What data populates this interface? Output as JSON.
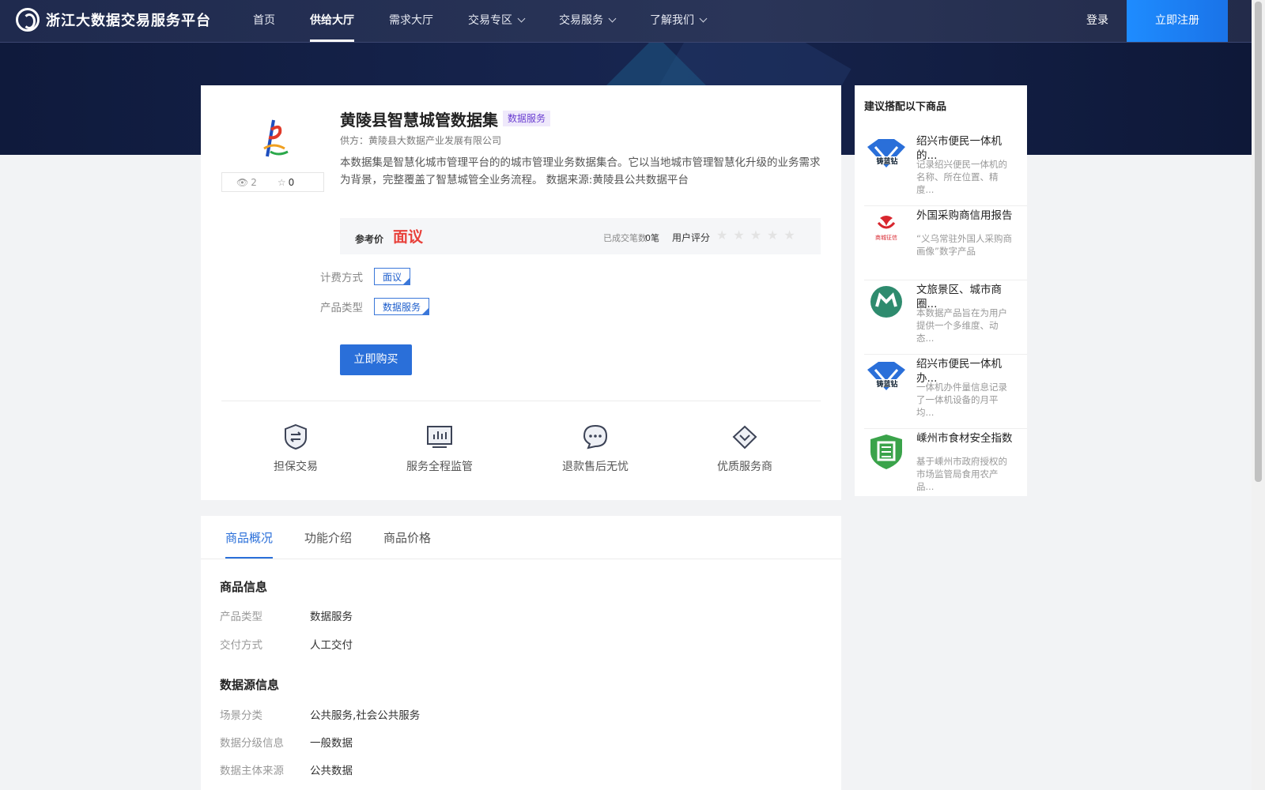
{
  "header": {
    "logo_text": "浙江大数据交易服务平台",
    "nav": [
      {
        "label": "首页"
      },
      {
        "label": "供给大厅"
      },
      {
        "label": "需求大厅"
      },
      {
        "label": "交易专区"
      },
      {
        "label": "交易服务"
      },
      {
        "label": "了解我们"
      }
    ],
    "login_label": "登录",
    "register_label": "立即注册"
  },
  "product": {
    "title": "黄陵县智慧城管数据集",
    "tag": "数据服务",
    "supplier": "供方：黄陵县大数据产业发展有限公司",
    "description": "本数据集是智慧化城市管理平台的的城市管理业务数据集合。它以当地城市管理智慧化升级的业务需求为背景，完整覆盖了智慧城管全业务流程。 数据来源:黄陵县公共数据平台",
    "views": "2",
    "favorites": "0",
    "ref_price_label": "参考价",
    "ref_price": "面议",
    "deal_count_label": "已成交笔数",
    "deal_count": "0笔",
    "rating_label": "用户评分",
    "rating": 0,
    "fee_label": "计费方式",
    "fee_value": "面议",
    "type_label": "产品类型",
    "type_value": "数据服务",
    "buy_label": "立即购买"
  },
  "features": [
    {
      "label": "担保交易",
      "icon": "shield-exchange-icon"
    },
    {
      "label": "服务全程监管",
      "icon": "monitor-chart-icon"
    },
    {
      "label": "退款售后无忧",
      "icon": "chat-bubble-icon"
    },
    {
      "label": "优质服务商",
      "icon": "diamond-icon"
    }
  ],
  "sidebar": {
    "title": "建议搭配以下商品",
    "items": [
      {
        "title": "绍兴市便民一体机的...",
        "desc": "记录绍兴便民一体机的名称、所在位置、精度...",
        "icon": "blue-diamond-logo-icon"
      },
      {
        "title": "外国采购商信用报告",
        "desc": "“义乌常驻外国人采购商画像”数字产品",
        "icon": "red-credit-logo-icon"
      },
      {
        "title": "文旅景区、城市商圈...",
        "desc": "本数据产品旨在为用户提供一个多维度、动态...",
        "icon": "green-circle-logo-icon"
      },
      {
        "title": "绍兴市便民一体机办...",
        "desc": "一体机办件量信息记录了一体机设备的月平均...",
        "icon": "blue-diamond-logo-icon"
      },
      {
        "title": "嵊州市食材安全指数",
        "desc": "基于嵊州市政府授权的市场监管局食用农产品...",
        "icon": "green-shield-logo-icon"
      }
    ]
  },
  "detail": {
    "tabs": [
      {
        "label": "商品概况"
      },
      {
        "label": "功能介绍"
      },
      {
        "label": "商品价格"
      }
    ],
    "product_info_title": "商品信息",
    "product_info": [
      {
        "k": "产品类型",
        "v": "数据服务"
      },
      {
        "k": "交付方式",
        "v": "人工交付"
      }
    ],
    "datasource_title": "数据源信息",
    "datasource": [
      {
        "k": "场景分类",
        "v": "公共服务,社会公共服务"
      },
      {
        "k": "数据分级信息",
        "v": "一般数据"
      },
      {
        "k": "数据主体来源",
        "v": "公共数据"
      }
    ]
  },
  "colors": {
    "accent": "#2a6fd9",
    "price": "#e8403a",
    "header_bg": "#24305a",
    "register_bg": "#1e8cff"
  }
}
